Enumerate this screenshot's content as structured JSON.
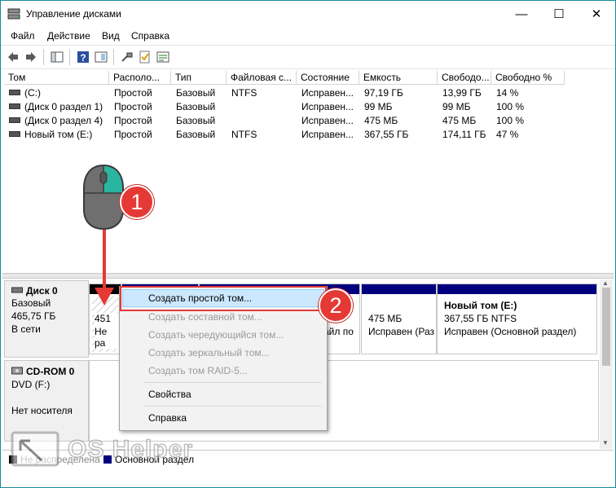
{
  "window": {
    "title": "Управление дисками",
    "controls": {
      "minimize": "—",
      "maximize": "☐",
      "close": "✕"
    }
  },
  "menu": [
    "Файл",
    "Действие",
    "Вид",
    "Справка"
  ],
  "toolbar_icons": [
    "back-arrow-icon",
    "forward-arrow-icon",
    "console-tree-icon",
    "help-icon",
    "help-book-icon",
    "connect-icon",
    "checkmark-doc-icon",
    "properties-icon"
  ],
  "volume_table": {
    "columns": [
      "Том",
      "Располо...",
      "Тип",
      "Файловая с...",
      "Состояние",
      "Емкость",
      "Свободо...",
      "Свободно %"
    ],
    "rows": [
      [
        "(C:)",
        "Простой",
        "Базовый",
        "NTFS",
        "Исправен...",
        "97,19 ГБ",
        "13,99 ГБ",
        "14 %"
      ],
      [
        "(Диск 0 раздел 1)",
        "Простой",
        "Базовый",
        "",
        "Исправен...",
        "99 МБ",
        "99 МБ",
        "100 %"
      ],
      [
        "(Диск 0 раздел 4)",
        "Простой",
        "Базовый",
        "",
        "Исправен...",
        "475 МБ",
        "475 МБ",
        "100 %"
      ],
      [
        "Новый том (E:)",
        "Простой",
        "Базовый",
        "NTFS",
        "Исправен...",
        "367,55 ГБ",
        "174,11 ГБ",
        "47 %"
      ]
    ]
  },
  "disks": [
    {
      "name": "Диск 0",
      "type": "Базовый",
      "size": "465,75 ГБ",
      "status": "В сети"
    },
    {
      "name": "CD-ROM 0",
      "type": "DVD (F:)",
      "size": "",
      "status": "Нет носителя"
    }
  ],
  "partitions": {
    "unallocated": {
      "line1": "451 М",
      "line2": "Не ра"
    },
    "p_mid": {
      "line2": "айл по"
    },
    "p475": {
      "size": "475 МБ",
      "status": "Исправен (Раз"
    },
    "newvol": {
      "name": "Новый том  (E:)",
      "size": "367,55 ГБ NTFS",
      "status": "Исправен (Основной раздел)"
    }
  },
  "context_menu": {
    "items": [
      {
        "label": "Создать простой том...",
        "enabled": true,
        "highlighted": true
      },
      {
        "label": "Создать составной том...",
        "enabled": false
      },
      {
        "label": "Создать чередующийся том...",
        "enabled": false
      },
      {
        "label": "Создать зеркальный том...",
        "enabled": false
      },
      {
        "label": "Создать том RAID-5...",
        "enabled": false
      },
      {
        "label": "Свойства",
        "enabled": true
      },
      {
        "label": "Справка",
        "enabled": true
      }
    ]
  },
  "legend": {
    "unallocated": "Не распределена",
    "primary": "Основной раздел"
  },
  "annotations": {
    "step1": "1",
    "step2": "2"
  },
  "watermark": "OS Helper",
  "colors": {
    "accent_frame": "#1c8a9a",
    "partition_bar": "#00007f",
    "highlight": "#cce8ff",
    "callout": "#e53935",
    "arrow": "#e53935"
  }
}
